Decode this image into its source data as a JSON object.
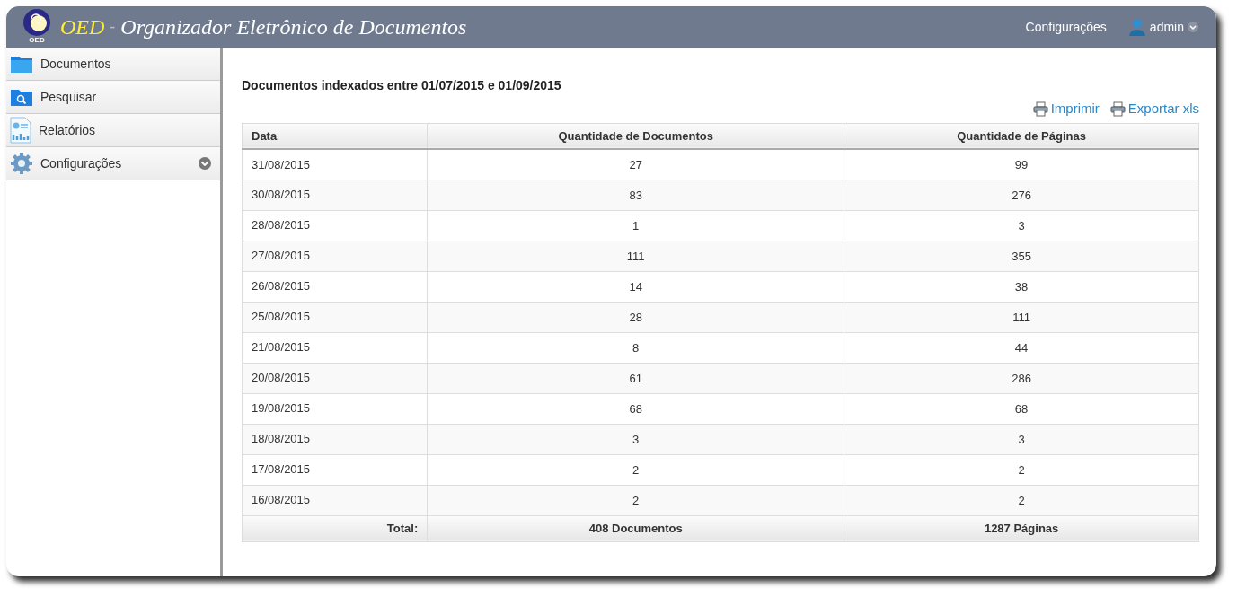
{
  "header": {
    "logo_caption": "OED",
    "app_short": "OED",
    "separator": "-",
    "app_title": "Organizador Eletrônico de Documentos",
    "nav_link": "Configurações",
    "user": "admin"
  },
  "sidebar": {
    "items": [
      {
        "label": "Documentos",
        "kind": "folder",
        "has_submenu": false
      },
      {
        "label": "Pesquisar",
        "kind": "search",
        "has_submenu": false
      },
      {
        "label": "Relatórios",
        "kind": "report",
        "has_submenu": false
      },
      {
        "label": "Configurações",
        "kind": "settings",
        "has_submenu": true
      }
    ]
  },
  "report": {
    "title": "Documentos indexados entre 01/07/2015 e 01/09/2015",
    "actions": [
      "Imprimir",
      "Exportar xls"
    ],
    "columns": [
      "Data",
      "Quantidade de Documentos",
      "Quantidade de Páginas"
    ],
    "rows": [
      [
        "31/08/2015",
        "27",
        "99"
      ],
      [
        "30/08/2015",
        "83",
        "276"
      ],
      [
        "28/08/2015",
        "1",
        "3"
      ],
      [
        "27/08/2015",
        "111",
        "355"
      ],
      [
        "26/08/2015",
        "14",
        "38"
      ],
      [
        "25/08/2015",
        "28",
        "111"
      ],
      [
        "21/08/2015",
        "8",
        "44"
      ],
      [
        "20/08/2015",
        "61",
        "286"
      ],
      [
        "19/08/2015",
        "68",
        "68"
      ],
      [
        "18/08/2015",
        "3",
        "3"
      ],
      [
        "17/08/2015",
        "2",
        "2"
      ],
      [
        "16/08/2015",
        "2",
        "2"
      ]
    ],
    "footer": [
      "Total:",
      "408 Documentos",
      "1287 Páginas"
    ]
  }
}
